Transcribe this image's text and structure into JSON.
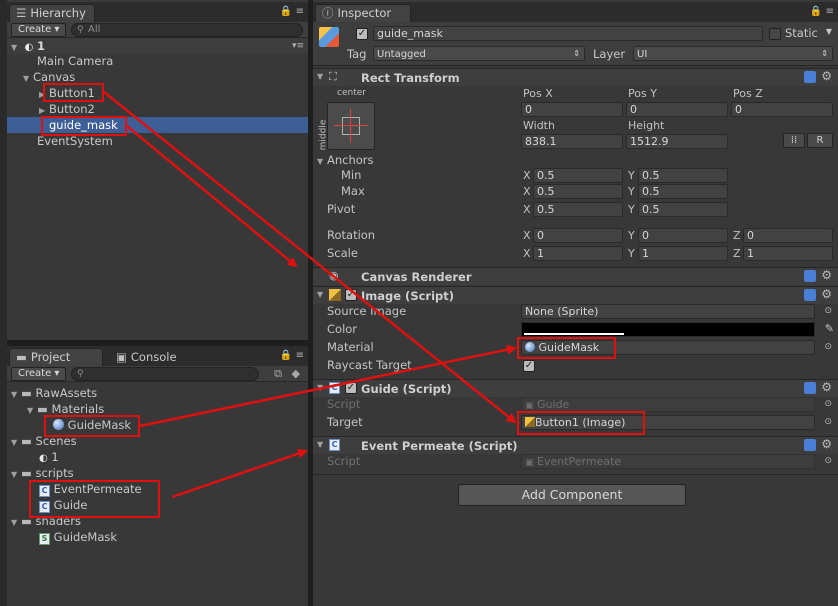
{
  "hierarchy": {
    "tab_label": "Hierarchy",
    "create_label": "Create",
    "search_placeholder": "All",
    "scene_name": "1",
    "items": [
      {
        "label": "Main Camera"
      },
      {
        "label": "Canvas"
      },
      {
        "label": "Button1"
      },
      {
        "label": "Button2"
      },
      {
        "label": "guide_mask"
      },
      {
        "label": "EventSystem"
      }
    ]
  },
  "project": {
    "tab_label": "Project",
    "console_tab_label": "Console",
    "create_label": "Create",
    "items": [
      {
        "label": "RawAssets"
      },
      {
        "label": "Materials"
      },
      {
        "label": "GuideMask"
      },
      {
        "label": "Scenes"
      },
      {
        "label": "1"
      },
      {
        "label": "scripts"
      },
      {
        "label": "EventPermeate"
      },
      {
        "label": "Guide"
      },
      {
        "label": "shaders"
      },
      {
        "label": "GuideMask"
      }
    ]
  },
  "inspector": {
    "tab_label": "Inspector",
    "object_name": "guide_mask",
    "active": true,
    "static_label": "Static",
    "tag_label": "Tag",
    "tag_value": "Untagged",
    "layer_label": "Layer",
    "layer_value": "UI",
    "rect_transform": {
      "title": "Rect Transform",
      "anchor_preset_h": "center",
      "anchor_preset_v": "middle",
      "pos_x_label": "Pos X",
      "pos_y_label": "Pos Y",
      "pos_z_label": "Pos Z",
      "pos_x": "0",
      "pos_y": "0",
      "pos_z": "0",
      "width_label": "Width",
      "height_label": "Height",
      "width": "838.1",
      "height": "1512.9",
      "r_button": "R",
      "anchors_label": "Anchors",
      "min_label": "Min",
      "max_label": "Max",
      "min_x": "0.5",
      "min_y": "0.5",
      "max_x": "0.5",
      "max_y": "0.5",
      "pivot_label": "Pivot",
      "pivot_x": "0.5",
      "pivot_y": "0.5",
      "rotation_label": "Rotation",
      "rot_x": "0",
      "rot_y": "0",
      "rot_z": "0",
      "scale_label": "Scale",
      "scale_x": "1",
      "scale_y": "1",
      "scale_z": "1",
      "x": "X",
      "y": "Y",
      "z": "Z"
    },
    "canvas_renderer": {
      "title": "Canvas Renderer"
    },
    "image": {
      "title": "Image (Script)",
      "source_image_label": "Source Image",
      "source_image_value": "None (Sprite)",
      "color_label": "Color",
      "material_label": "Material",
      "material_value": "GuideMask",
      "raycast_label": "Raycast Target"
    },
    "guide": {
      "title": "Guide (Script)",
      "script_label": "Script",
      "script_value": "Guide",
      "target_label": "Target",
      "target_value": "Button1 (Image)"
    },
    "event_permeate": {
      "title": "Event Permeate (Script)",
      "script_label": "Script",
      "script_value": "EventPermeate"
    },
    "add_component_label": "Add Component"
  },
  "colors": {
    "annotation": "#e01010",
    "selection": "#3e5f96"
  }
}
